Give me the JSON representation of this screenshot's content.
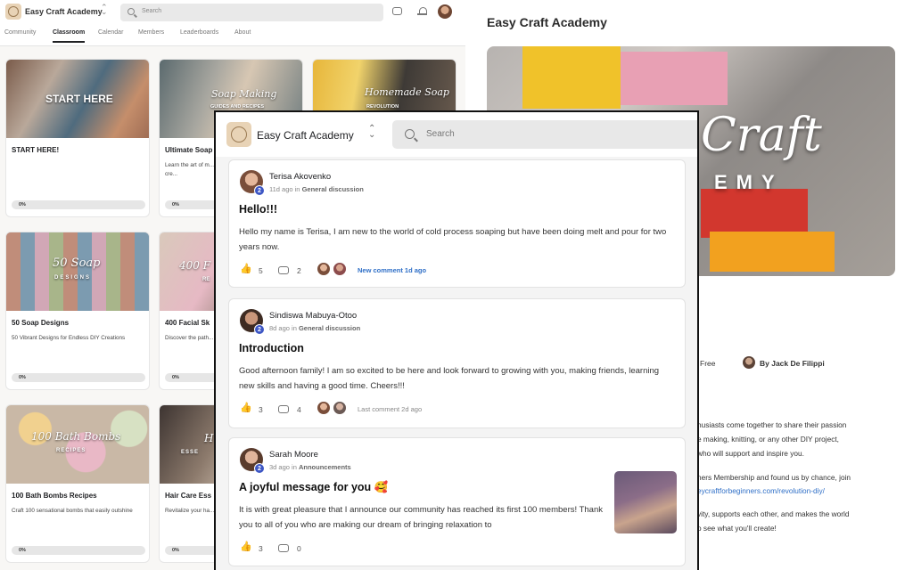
{
  "classroom": {
    "app_title": "Easy Craft Academy",
    "search_placeholder": "Search",
    "tabs": [
      "Community",
      "Classroom",
      "Calendar",
      "Members",
      "Leaderboards",
      "About"
    ],
    "active_tab": "Classroom",
    "courses": [
      {
        "title": "START HERE!",
        "desc": "",
        "progress": "0%",
        "banner": "START HERE"
      },
      {
        "title": "Ultimate Soap",
        "desc": "Learn the art of m... soap while calmi... boosting your cre...",
        "progress": "0%",
        "banner": "Soap Making",
        "banner_sub": "GUIDES AND RECIPES"
      },
      {
        "title": "",
        "desc": "",
        "progress": "",
        "banner": "Homemade Soap",
        "banner_sub": "REVOLUTION"
      },
      {
        "title": "50 Soap Designs",
        "desc": "50 Vibrant Designs for Endless DIY Creations",
        "progress": "0%",
        "banner": "50 Soap",
        "banner_sub": "DESIGNS"
      },
      {
        "title": "400 Facial Sk",
        "desc": "Discover the path... hydrated skin in l...",
        "progress": "0%",
        "banner": "400 F",
        "banner_sub": "RE"
      },
      {
        "title": "100 Bath Bombs Recipes",
        "desc": "Craft 100 sensational bombs that easily outshine",
        "progress": "0%",
        "banner": "100 Bath Bombs",
        "banner_sub": "RECIPES"
      },
      {
        "title": "Hair Care Ess",
        "desc": "Revitalize your ha...",
        "progress": "0%",
        "banner": "H",
        "banner_sub": "ESSE"
      }
    ]
  },
  "about": {
    "title": "Easy Craft Academy",
    "hero_text_1": "Craft",
    "hero_text_2": "EMY",
    "price": "Free",
    "author": "By Jack De Filippi",
    "para": [
      "husiasts come together to share their passion",
      "e making, knitting, or any other DIY project,",
      "who will support and inspire you.",
      "",
      "ners Membership and found us by chance, join",
      "",
      "vity, supports each other, and makes the world",
      "o see what you'll create!"
    ],
    "link": "eycraftforbeginners.com/revolution-diy/"
  },
  "community": {
    "app_title": "Easy Craft Academy",
    "search_placeholder": "Search",
    "posts": [
      {
        "author": "Terisa Akovenko",
        "level": "2",
        "time": "11d ago in",
        "category": "General discussion",
        "title": "Hello!!!",
        "body": "Hello my name is Terisa, I am new to the world of cold process soaping but have been doing melt and pour for two years now.",
        "likes": "5",
        "comments": "2",
        "last_comment": "New comment 1d ago"
      },
      {
        "author": "Sindiswa Mabuya-Otoo",
        "level": "2",
        "time": "8d ago in",
        "category": "General discussion",
        "title": "Introduction",
        "body": "Good afternoon family! I am so excited to be here and look forward to growing with you, making friends, learning new skills and having a good time. Cheers!!!",
        "likes": "3",
        "comments": "4",
        "last_comment": "Last comment 2d ago"
      },
      {
        "author": "Sarah Moore",
        "level": "2",
        "time": "3d ago in",
        "category": "Announcements",
        "title": "A joyful message for you 🥰",
        "body": "It is with great pleasure that I announce our community has reached its first 100 members! Thank you to all of you who are making our dream of bringing relaxation to",
        "likes": "3",
        "comments": "0"
      }
    ]
  },
  "colors": {
    "accent_blue": "#2f6fc7",
    "level_badge": "#3d56c4",
    "like_gold": "#d79a12",
    "logo_bg": "#e8d3b6"
  }
}
